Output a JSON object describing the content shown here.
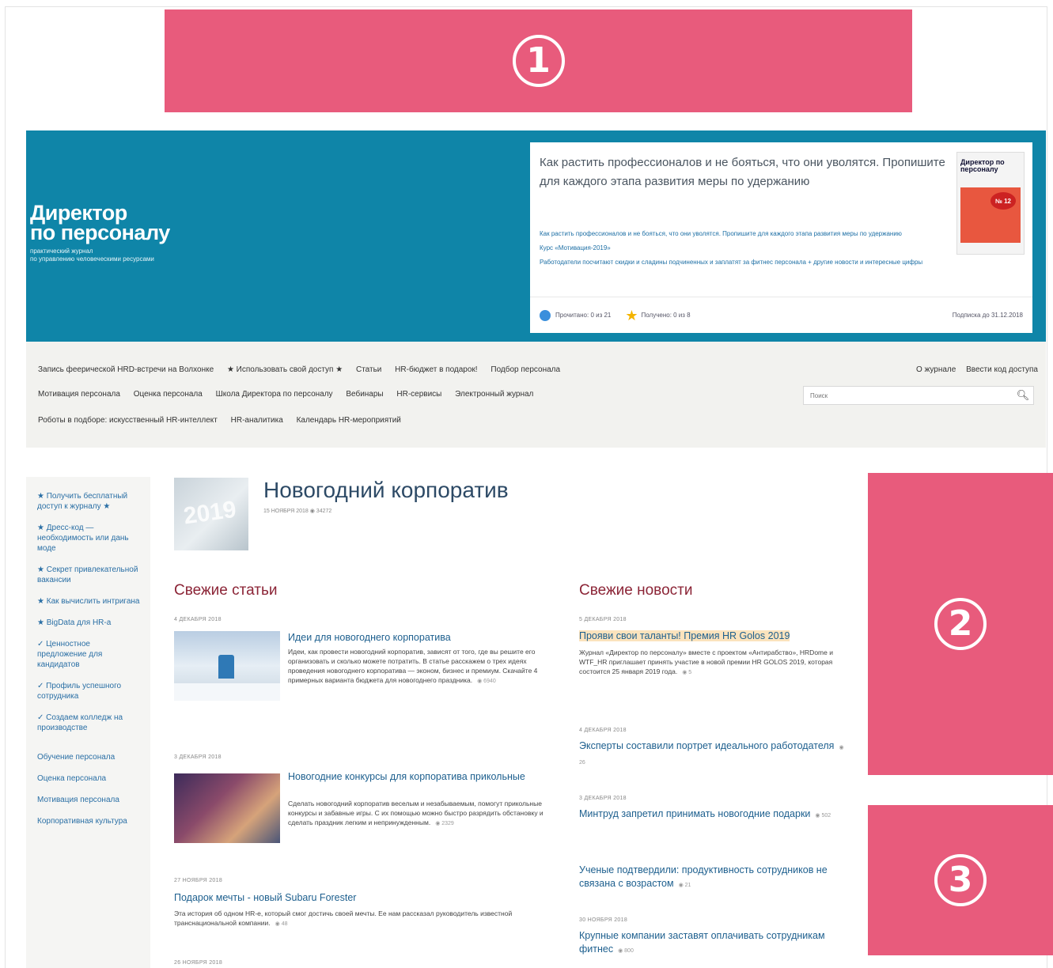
{
  "ads": [
    {
      "label": "1"
    },
    {
      "label": "2"
    },
    {
      "label": "3"
    }
  ],
  "logo": {
    "line1": "Директор",
    "line2": "по персоналу",
    "sub1": "практический журнал",
    "sub2": "по управлению человеческими ресурсами"
  },
  "promo": {
    "title": "Как растить профессионалов и не бояться, что они уволятся. Пропишите для каждого этапа развития меры по удержанию",
    "links": [
      "Как растить профессионалов и не бояться, что они уволятся. Пропишите для каждого этапа развития меры по удержанию",
      "Курс «Мотивация-2019»",
      "Работодатели посчитают скидки и сладины подчиненных и заплатят за фитнес персонала + другие новости и интересные цифры"
    ],
    "cover_name": "Директор по персоналу",
    "cover_badge": "№ 12",
    "read": "Прочитано: 0 из 21",
    "received": "Получено: 0 из 8",
    "subscription": "Подписка до 31.12.2018"
  },
  "nav": {
    "row1": [
      "Запись феерической HRD-встречи на Волхонке",
      "★ Использовать свой доступ ★",
      "Статьи",
      "HR-бюджет в подарок!",
      "Подбор персонала"
    ],
    "row2": [
      "Мотивация персонала",
      "Оценка персонала",
      "Школа Директора по персоналу",
      "Вебинары",
      "HR-сервисы",
      "Электронный журнал"
    ],
    "row3": [
      "Роботы в подборе: искусственный HR-интеллект",
      "HR-аналитика",
      "Календарь HR-мероприятий"
    ],
    "about": "О журнале",
    "access_code": "Ввести код доступа",
    "search_placeholder": "Поиск"
  },
  "sidebar": {
    "items": [
      "★ Получить бесплатный доступ к журналу ★",
      "★ Дресс-код — необходимость или дань моде",
      "★ Секрет привлекательной вакансии",
      "★ Как вычислить интригана",
      "★ BigData для HR-а",
      "✓ Ценностное предложение для кандидатов",
      "✓ Профиль успешного сотрудника",
      "✓ Создаем колледж на производстве"
    ],
    "sections": [
      "Обучение персонала",
      "Оценка персонала",
      "Мотивация персонала",
      "Корпоративная культура"
    ]
  },
  "page": {
    "thumb_text": "2019",
    "title": "Новогодний корпоратив",
    "meta": "15 НОЯБРЯ 2018   ◉ 34272"
  },
  "articles": {
    "title": "Свежие статьи",
    "items": [
      {
        "date": "4 ДЕКАБРЯ 2018",
        "head": "Идеи для новогоднего корпоратива",
        "text": "Идеи, как провести новогодний корпоратив, зависят от того, где вы решите его организовать и сколько можете потратить. В статье расскажем о трех идеях проведения новогоднего корпоратива — эконом, бизнес и премиум. Скачайте 4 примерных варианта бюджета для новогоднего праздника.",
        "views": "◉ 6940"
      },
      {
        "date": "3 ДЕКАБРЯ 2018",
        "head": "Новогодние конкурсы для корпоратива прикольные",
        "text": "Сделать новогодний корпоратив веселым и незабываемым, помогут прикольные конкурсы и забавные игры. С их помощью можно быстро разрядить обстановку и сделать праздник легким и непринужденным.",
        "views": "◉ 2329"
      },
      {
        "date": "27 НОЯБРЯ 2018",
        "head": "Подарок мечты - новый Subaru Forester",
        "text": "Эта история об одном HR-е, который смог достичь своей мечты. Ее нам рассказал руководитель известной транснациональной компании.",
        "views": "◉ 48"
      },
      {
        "date": "26 НОЯБРЯ 2018"
      }
    ]
  },
  "news": {
    "title": "Свежие новости",
    "items": [
      {
        "date": "5 ДЕКАБРЯ 2018",
        "head": "Прояви свои таланты! Премия HR Golos 2019",
        "text": "Журнал «Директор по персоналу» вместе с проектом «Антирабство», HRDome и WTF_HR приглашает принять участие в новой премии HR GOLOS 2019, которая состоится 25 января 2019 года.",
        "views": "◉ 5"
      },
      {
        "date": "4 ДЕКАБРЯ 2018",
        "head": "Эксперты составили портрет идеального работодателя",
        "views": "◉ 26"
      },
      {
        "date": "3 ДЕКАБРЯ 2018",
        "head": "Минтруд запретил принимать новогодние подарки",
        "views": "◉ 502"
      },
      {
        "head": "Ученые подтвердили: продуктивность сотрудников не связана с возрастом",
        "views": "◉ 21"
      },
      {
        "date": "30 НОЯБРЯ 2018",
        "head": "Крупные компании заставят оплачивать сотрудникам фитнес",
        "views": "◉ 800"
      }
    ]
  }
}
